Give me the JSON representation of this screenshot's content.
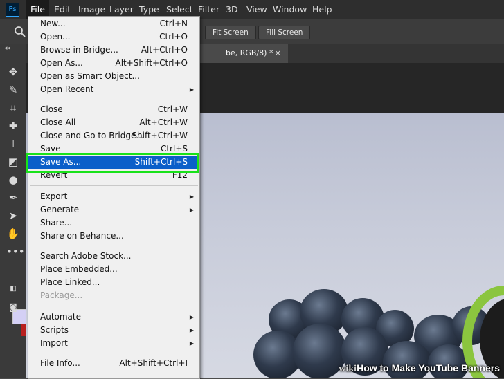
{
  "menubar": {
    "logo": "Ps",
    "items": [
      "File",
      "Edit",
      "Image",
      "Layer",
      "Type",
      "Select",
      "Filter",
      "3D",
      "View",
      "Window",
      "Help"
    ]
  },
  "optionsbar": {
    "fit_screen": "Fit Screen",
    "fill_screen": "Fill Screen"
  },
  "document_tab": {
    "title": "be, RGB/8) *",
    "close": "×"
  },
  "file_menu": {
    "items": [
      {
        "label": "New...",
        "shortcut": "Ctrl+N"
      },
      {
        "label": "Open...",
        "shortcut": "Ctrl+O"
      },
      {
        "label": "Browse in Bridge...",
        "shortcut": "Alt+Ctrl+O"
      },
      {
        "label": "Open As...",
        "shortcut": "Alt+Shift+Ctrl+O"
      },
      {
        "label": "Open as Smart Object...",
        "shortcut": ""
      },
      {
        "label": "Open Recent",
        "shortcut": ""
      },
      {
        "label": "Close",
        "shortcut": "Ctrl+W"
      },
      {
        "label": "Close All",
        "shortcut": "Alt+Ctrl+W"
      },
      {
        "label": "Close and Go to Bridge...",
        "shortcut": "Shift+Ctrl+W"
      },
      {
        "label": "Save",
        "shortcut": "Ctrl+S"
      },
      {
        "label": "Save As...",
        "shortcut": "Shift+Ctrl+S"
      },
      {
        "label": "Revert",
        "shortcut": "F12"
      },
      {
        "label": "Export",
        "shortcut": ""
      },
      {
        "label": "Generate",
        "shortcut": ""
      },
      {
        "label": "Share...",
        "shortcut": ""
      },
      {
        "label": "Share on Behance...",
        "shortcut": ""
      },
      {
        "label": "Search Adobe Stock...",
        "shortcut": ""
      },
      {
        "label": "Place Embedded...",
        "shortcut": ""
      },
      {
        "label": "Place Linked...",
        "shortcut": ""
      },
      {
        "label": "Package...",
        "shortcut": ""
      },
      {
        "label": "Automate",
        "shortcut": ""
      },
      {
        "label": "Scripts",
        "shortcut": ""
      },
      {
        "label": "Import",
        "shortcut": ""
      },
      {
        "label": "File Info...",
        "shortcut": "Alt+Shift+Ctrl+I"
      }
    ],
    "selected": "Save As...",
    "disabled": [
      "Package..."
    ],
    "submenus": [
      "Open Recent",
      "Export",
      "Generate",
      "Automate",
      "Scripts",
      "Import"
    ]
  },
  "watermark": {
    "wiki": "wiki",
    "text": "How to Make YouTube Banners"
  },
  "colors": {
    "highlight": "#19e21a",
    "selection": "#0b5fc9",
    "foreground_swatch": "#d4d0f5",
    "background_swatch": "#b82020"
  }
}
